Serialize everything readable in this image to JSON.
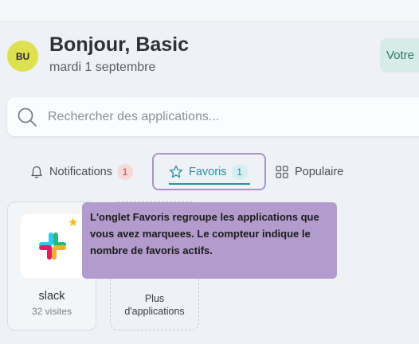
{
  "header": {
    "avatar_initials": "BU",
    "greeting": "Bonjour, Basic",
    "date": "mardi 1 septembre",
    "vote_label": "Votre"
  },
  "search": {
    "placeholder": "Rechercher des applications..."
  },
  "tabs": {
    "notifications": {
      "label": "Notifications",
      "count": "1"
    },
    "favorites": {
      "label": "Favoris",
      "count": "1"
    },
    "popular": {
      "label": "Populaire"
    }
  },
  "apps": [
    {
      "name": "slack",
      "visits": "32 visites",
      "favorite": true
    }
  ],
  "more_apps": {
    "label_line1": "Plus",
    "label_line2": "d'applications"
  },
  "tooltip": {
    "text": "L'onglet Favoris regroupe les applications que vous avez marquees. Le compteur indique le nombre de favoris actifs."
  },
  "colors": {
    "accent": "#2a8ea0",
    "tooltip_bg": "#b39ccd",
    "avatar_bg": "#dde04f",
    "star": "#f1b71b"
  }
}
